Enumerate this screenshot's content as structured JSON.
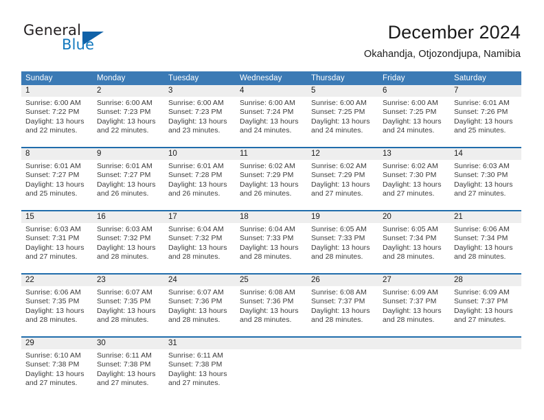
{
  "brand": {
    "word_one": "General",
    "word_two": "Blue",
    "flag_icon": "triangle-flag-icon",
    "accent_color": "#1062a8",
    "blue_text_color": "#1278be"
  },
  "header": {
    "title": "December 2024",
    "subtitle": "Okahandja, Otjozondjupa, Namibia"
  },
  "calendar": {
    "header_bg": "#3b7ab5",
    "week_rule_color": "#1f6cab",
    "daynum_bg": "#eeeeee",
    "weekdays": [
      "Sunday",
      "Monday",
      "Tuesday",
      "Wednesday",
      "Thursday",
      "Friday",
      "Saturday"
    ],
    "weeks": [
      [
        {
          "day": "1",
          "lines": [
            "Sunrise: 6:00 AM",
            "Sunset: 7:22 PM",
            "Daylight: 13 hours",
            "and 22 minutes."
          ]
        },
        {
          "day": "2",
          "lines": [
            "Sunrise: 6:00 AM",
            "Sunset: 7:23 PM",
            "Daylight: 13 hours",
            "and 22 minutes."
          ]
        },
        {
          "day": "3",
          "lines": [
            "Sunrise: 6:00 AM",
            "Sunset: 7:23 PM",
            "Daylight: 13 hours",
            "and 23 minutes."
          ]
        },
        {
          "day": "4",
          "lines": [
            "Sunrise: 6:00 AM",
            "Sunset: 7:24 PM",
            "Daylight: 13 hours",
            "and 24 minutes."
          ]
        },
        {
          "day": "5",
          "lines": [
            "Sunrise: 6:00 AM",
            "Sunset: 7:25 PM",
            "Daylight: 13 hours",
            "and 24 minutes."
          ]
        },
        {
          "day": "6",
          "lines": [
            "Sunrise: 6:00 AM",
            "Sunset: 7:25 PM",
            "Daylight: 13 hours",
            "and 24 minutes."
          ]
        },
        {
          "day": "7",
          "lines": [
            "Sunrise: 6:01 AM",
            "Sunset: 7:26 PM",
            "Daylight: 13 hours",
            "and 25 minutes."
          ]
        }
      ],
      [
        {
          "day": "8",
          "lines": [
            "Sunrise: 6:01 AM",
            "Sunset: 7:27 PM",
            "Daylight: 13 hours",
            "and 25 minutes."
          ]
        },
        {
          "day": "9",
          "lines": [
            "Sunrise: 6:01 AM",
            "Sunset: 7:27 PM",
            "Daylight: 13 hours",
            "and 26 minutes."
          ]
        },
        {
          "day": "10",
          "lines": [
            "Sunrise: 6:01 AM",
            "Sunset: 7:28 PM",
            "Daylight: 13 hours",
            "and 26 minutes."
          ]
        },
        {
          "day": "11",
          "lines": [
            "Sunrise: 6:02 AM",
            "Sunset: 7:29 PM",
            "Daylight: 13 hours",
            "and 26 minutes."
          ]
        },
        {
          "day": "12",
          "lines": [
            "Sunrise: 6:02 AM",
            "Sunset: 7:29 PM",
            "Daylight: 13 hours",
            "and 27 minutes."
          ]
        },
        {
          "day": "13",
          "lines": [
            "Sunrise: 6:02 AM",
            "Sunset: 7:30 PM",
            "Daylight: 13 hours",
            "and 27 minutes."
          ]
        },
        {
          "day": "14",
          "lines": [
            "Sunrise: 6:03 AM",
            "Sunset: 7:30 PM",
            "Daylight: 13 hours",
            "and 27 minutes."
          ]
        }
      ],
      [
        {
          "day": "15",
          "lines": [
            "Sunrise: 6:03 AM",
            "Sunset: 7:31 PM",
            "Daylight: 13 hours",
            "and 27 minutes."
          ]
        },
        {
          "day": "16",
          "lines": [
            "Sunrise: 6:03 AM",
            "Sunset: 7:32 PM",
            "Daylight: 13 hours",
            "and 28 minutes."
          ]
        },
        {
          "day": "17",
          "lines": [
            "Sunrise: 6:04 AM",
            "Sunset: 7:32 PM",
            "Daylight: 13 hours",
            "and 28 minutes."
          ]
        },
        {
          "day": "18",
          "lines": [
            "Sunrise: 6:04 AM",
            "Sunset: 7:33 PM",
            "Daylight: 13 hours",
            "and 28 minutes."
          ]
        },
        {
          "day": "19",
          "lines": [
            "Sunrise: 6:05 AM",
            "Sunset: 7:33 PM",
            "Daylight: 13 hours",
            "and 28 minutes."
          ]
        },
        {
          "day": "20",
          "lines": [
            "Sunrise: 6:05 AM",
            "Sunset: 7:34 PM",
            "Daylight: 13 hours",
            "and 28 minutes."
          ]
        },
        {
          "day": "21",
          "lines": [
            "Sunrise: 6:06 AM",
            "Sunset: 7:34 PM",
            "Daylight: 13 hours",
            "and 28 minutes."
          ]
        }
      ],
      [
        {
          "day": "22",
          "lines": [
            "Sunrise: 6:06 AM",
            "Sunset: 7:35 PM",
            "Daylight: 13 hours",
            "and 28 minutes."
          ]
        },
        {
          "day": "23",
          "lines": [
            "Sunrise: 6:07 AM",
            "Sunset: 7:35 PM",
            "Daylight: 13 hours",
            "and 28 minutes."
          ]
        },
        {
          "day": "24",
          "lines": [
            "Sunrise: 6:07 AM",
            "Sunset: 7:36 PM",
            "Daylight: 13 hours",
            "and 28 minutes."
          ]
        },
        {
          "day": "25",
          "lines": [
            "Sunrise: 6:08 AM",
            "Sunset: 7:36 PM",
            "Daylight: 13 hours",
            "and 28 minutes."
          ]
        },
        {
          "day": "26",
          "lines": [
            "Sunrise: 6:08 AM",
            "Sunset: 7:37 PM",
            "Daylight: 13 hours",
            "and 28 minutes."
          ]
        },
        {
          "day": "27",
          "lines": [
            "Sunrise: 6:09 AM",
            "Sunset: 7:37 PM",
            "Daylight: 13 hours",
            "and 28 minutes."
          ]
        },
        {
          "day": "28",
          "lines": [
            "Sunrise: 6:09 AM",
            "Sunset: 7:37 PM",
            "Daylight: 13 hours",
            "and 27 minutes."
          ]
        }
      ],
      [
        {
          "day": "29",
          "lines": [
            "Sunrise: 6:10 AM",
            "Sunset: 7:38 PM",
            "Daylight: 13 hours",
            "and 27 minutes."
          ]
        },
        {
          "day": "30",
          "lines": [
            "Sunrise: 6:11 AM",
            "Sunset: 7:38 PM",
            "Daylight: 13 hours",
            "and 27 minutes."
          ]
        },
        {
          "day": "31",
          "lines": [
            "Sunrise: 6:11 AM",
            "Sunset: 7:38 PM",
            "Daylight: 13 hours",
            "and 27 minutes."
          ]
        },
        {
          "day": "",
          "lines": []
        },
        {
          "day": "",
          "lines": []
        },
        {
          "day": "",
          "lines": []
        },
        {
          "day": "",
          "lines": []
        }
      ]
    ]
  }
}
